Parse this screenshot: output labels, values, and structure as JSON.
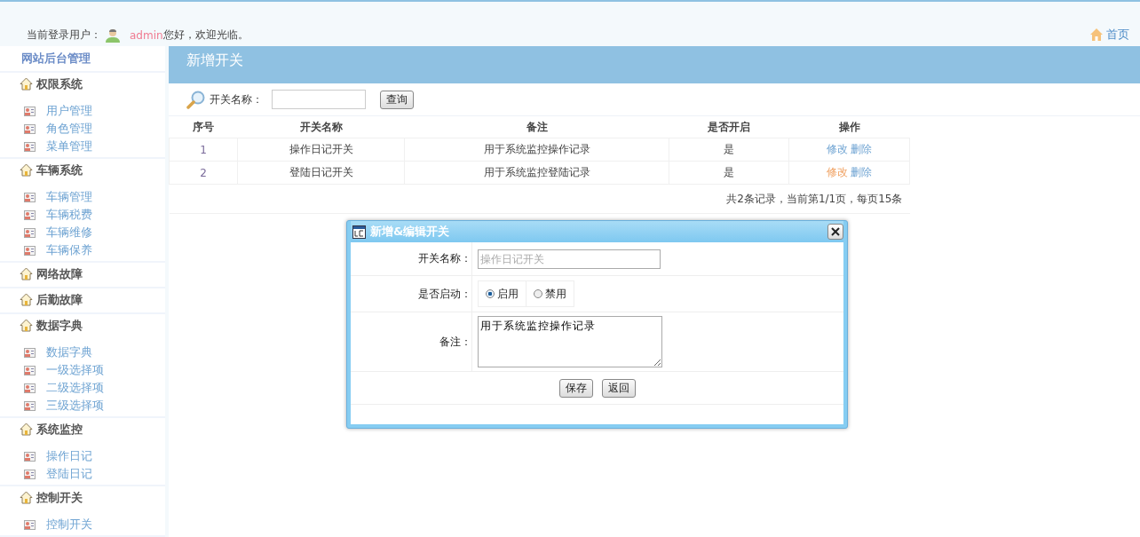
{
  "header": {
    "login_label": "当前登录用户：",
    "username": "admin",
    "greeting": "您好，欢迎光临。",
    "home_link": "首页"
  },
  "sidebar": {
    "title": "网站后台管理",
    "groups": [
      {
        "label": "权限系统",
        "items": [
          "用户管理",
          "角色管理",
          "菜单管理"
        ]
      },
      {
        "label": "车辆系统",
        "items": [
          "车辆管理",
          "车辆税费",
          "车辆维修",
          "车辆保养"
        ]
      },
      {
        "label": "网络故障"
      },
      {
        "label": "后勤故障"
      },
      {
        "label": "数据字典",
        "items": [
          "数据字典",
          "一级选择项",
          "二级选择项",
          "三级选择项"
        ]
      },
      {
        "label": "系统监控",
        "items": [
          "操作日记",
          "登陆日记"
        ]
      },
      {
        "label": "控制开关",
        "items": [
          "控制开关"
        ]
      }
    ]
  },
  "page": {
    "title": "新增开关",
    "search": {
      "label": "开关名称：",
      "button": "查询"
    },
    "table": {
      "columns": [
        "序号",
        "开关名称",
        "备注",
        "是否开启",
        "操作"
      ],
      "rows": [
        {
          "index": "1",
          "name": "操作日记开关",
          "note": "用于系统监控操作记录",
          "enabled": "是",
          "edit": "修改",
          "delete": "删除",
          "edit_hovered": false
        },
        {
          "index": "2",
          "name": "登陆日记开关",
          "note": "用于系统监控登陆记录",
          "enabled": "是",
          "edit": "修改",
          "delete": "删除",
          "edit_hovered": true
        }
      ]
    },
    "pagination": "共2条记录，当前第1/1页，每页15条"
  },
  "dialog": {
    "title": "新增&编辑开关",
    "name_label": "开关名称：",
    "name_placeholder": "操作日记开关",
    "status_label": "是否启动：",
    "options": [
      {
        "label": "启用",
        "selected": true
      },
      {
        "label": "禁用",
        "selected": false
      }
    ],
    "note_label": "备注：",
    "note_value": "用于系统监控操作记录",
    "buttons": [
      "保存",
      "返回"
    ]
  }
}
